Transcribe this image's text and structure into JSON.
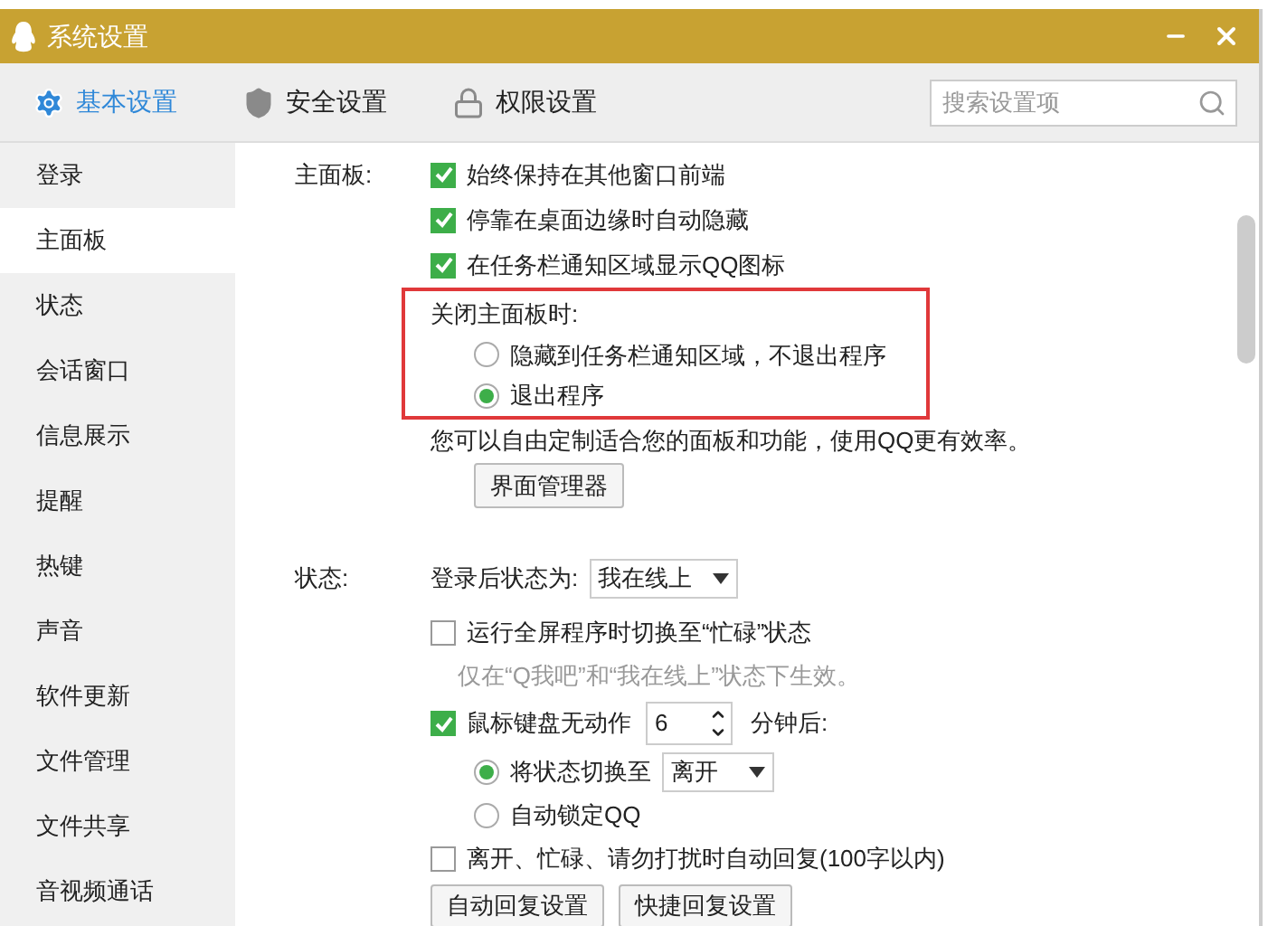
{
  "window": {
    "title": "系统设置"
  },
  "tabs": [
    {
      "label": "基本设置",
      "selected": true,
      "kind": "gear"
    },
    {
      "label": "安全设置",
      "selected": false,
      "kind": "shield"
    },
    {
      "label": "权限设置",
      "selected": false,
      "kind": "lock"
    }
  ],
  "search": {
    "placeholder": "搜索设置项"
  },
  "sidebar": {
    "items": [
      {
        "label": "登录",
        "selected": false
      },
      {
        "label": "主面板",
        "selected": true
      },
      {
        "label": "状态",
        "selected": false
      },
      {
        "label": "会话窗口",
        "selected": false
      },
      {
        "label": "信息展示",
        "selected": false
      },
      {
        "label": "提醒",
        "selected": false
      },
      {
        "label": "热键",
        "selected": false
      },
      {
        "label": "声音",
        "selected": false
      },
      {
        "label": "软件更新",
        "selected": false
      },
      {
        "label": "文件管理",
        "selected": false
      },
      {
        "label": "文件共享",
        "selected": false
      },
      {
        "label": "音视频通话",
        "selected": false
      }
    ]
  },
  "main_panel": {
    "label": "主面板:",
    "checkboxes": [
      {
        "label": "始终保持在其他窗口前端",
        "checked": true
      },
      {
        "label": "停靠在桌面边缘时自动隐藏",
        "checked": true
      },
      {
        "label": "在任务栏通知区域显示QQ图标",
        "checked": true
      }
    ],
    "close_group": {
      "title": "关闭主面板时:",
      "highlighted": true,
      "options": [
        {
          "label": "隐藏到任务栏通知区域，不退出程序",
          "selected": false
        },
        {
          "label": "退出程序",
          "selected": true
        }
      ]
    },
    "note": "您可以自由定制适合您的面板和功能，使用QQ更有效率。",
    "button": "界面管理器"
  },
  "status": {
    "label": "状态:",
    "login_status": {
      "label": "登录后状态为:",
      "value": "我在线上"
    },
    "fullscreen_busy": {
      "label": "运行全屏程序时切换至“忙碌”状态",
      "checked": false
    },
    "hint": "仅在“Q我吧”和“我在线上”状态下生效。",
    "idle": {
      "label": "鼠标键盘无动作",
      "checked": true,
      "minutes": "6",
      "suffix": "分钟后:",
      "options": [
        {
          "label": "将状态切换至",
          "selected": true,
          "dropdown": "离开"
        },
        {
          "label": "自动锁定QQ",
          "selected": false
        }
      ]
    },
    "auto_reply": {
      "label": "离开、忙碌、请勿打扰时自动回复(100字以内)",
      "checked": false
    },
    "buttons": [
      "自动回复设置",
      "快捷回复设置"
    ]
  }
}
